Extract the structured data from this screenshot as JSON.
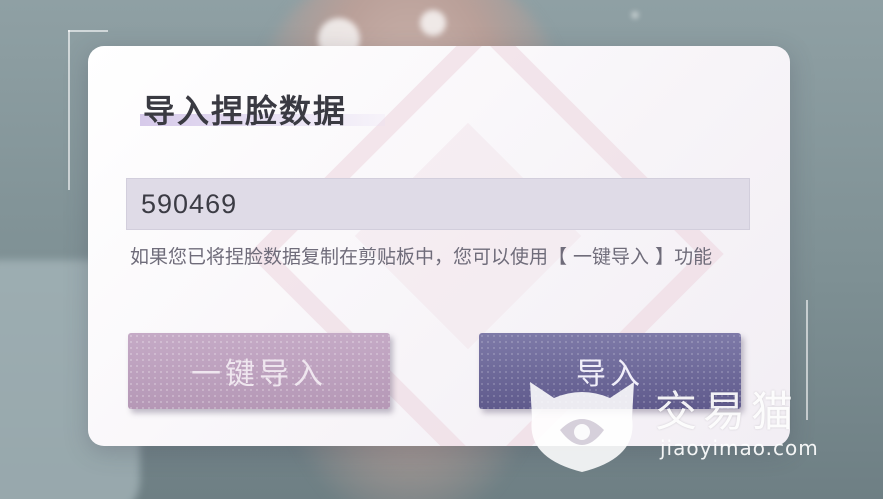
{
  "dialog": {
    "title": "导入捏脸数据",
    "input_value": "590469",
    "hint": "如果您已将捏脸数据复制在剪贴板中，您可以使用【 一键导入 】功能",
    "one_key_import_label": "一键导入",
    "import_label": "导入"
  },
  "watermark": {
    "name": "交易猫",
    "url": "jiaoyimao.com"
  },
  "colors": {
    "panel_bg": "#f7f4f8",
    "one_key_button": "#bca0bd",
    "import_button": "#6e699a",
    "title_text": "#3a3a42",
    "hint_text": "#6f6c7a"
  }
}
